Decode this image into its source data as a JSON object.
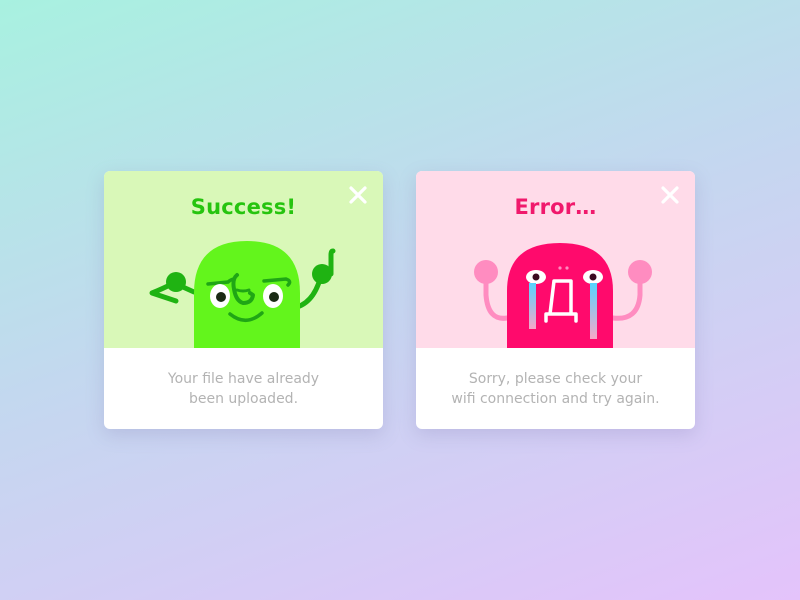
{
  "success": {
    "title": "Success!",
    "message_line1": "Your file have already",
    "message_line2": "been uploaded.",
    "close_icon": "close-icon",
    "colors": {
      "panel": "#d9f8b8",
      "accent": "#26c40f",
      "mascot": "#63f51c"
    }
  },
  "error": {
    "title": "Error…",
    "message_line1": "Sorry, please check your",
    "message_line2": "wifi connection and try again.",
    "close_icon": "close-icon",
    "colors": {
      "panel": "#ffdbe9",
      "accent": "#f0196c",
      "mascot": "#ff0a6c"
    }
  }
}
